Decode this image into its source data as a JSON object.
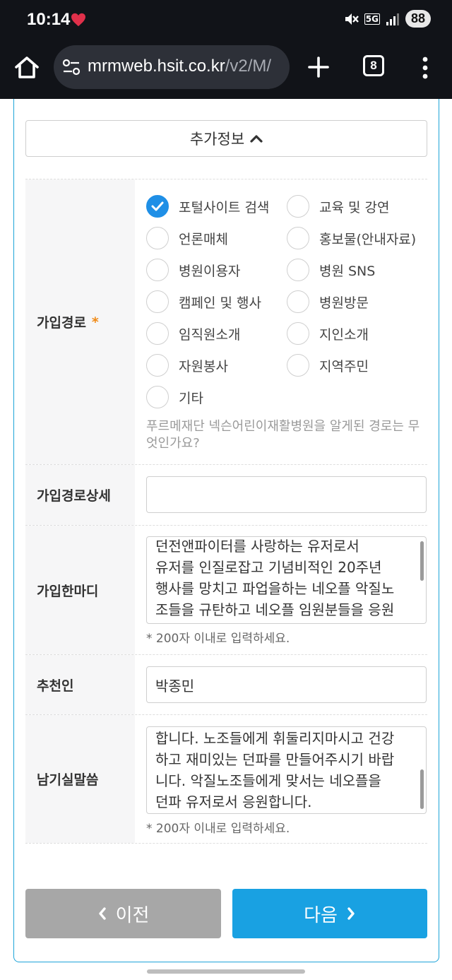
{
  "status": {
    "time": "10:14",
    "network": "5G",
    "battery": "88"
  },
  "browser": {
    "url_main": "mrmweb.hsit.co.kr",
    "url_path": "/v2/M/",
    "tab_count": "8"
  },
  "section_toggle": {
    "label": "추가정보"
  },
  "fields": {
    "join_route": {
      "label": "가입경로",
      "required": "*",
      "options": [
        {
          "label": "포털사이트 검색",
          "checked": true
        },
        {
          "label": "교육 및 강연",
          "checked": false
        },
        {
          "label": "언론매체",
          "checked": false
        },
        {
          "label": "홍보물(안내자료)",
          "checked": false
        },
        {
          "label": "병원이용자",
          "checked": false
        },
        {
          "label": "병원 SNS",
          "checked": false
        },
        {
          "label": "캠페인 및 행사",
          "checked": false
        },
        {
          "label": "병원방문",
          "checked": false
        },
        {
          "label": "임직원소개",
          "checked": false
        },
        {
          "label": "지인소개",
          "checked": false
        },
        {
          "label": "자원봉사",
          "checked": false
        },
        {
          "label": "지역주민",
          "checked": false
        },
        {
          "label": "기타",
          "checked": false
        }
      ],
      "hint": "푸르메재단 넥슨어린이재활병원을 알게된 경로는 무엇인가요?"
    },
    "join_route_detail": {
      "label": "가입경로상세",
      "value": ""
    },
    "join_message": {
      "label": "가입한마디",
      "lines": [
        "던전앤파이터를 사랑하는 유저로서",
        "유저를 인질로잡고 기념비적인 20주년",
        "행사를 망치고 파업을하는 네오플 악질노",
        "조들을 규탄하고 네오플 임원분들을 응원"
      ],
      "note": "* 200자 이내로 입력하세요."
    },
    "recommender": {
      "label": "추천인",
      "value": "박종민"
    },
    "leave_words": {
      "label": "남기실말씀",
      "lines": [
        "합니다. 노조들에게 휘둘리지마시고 건강",
        "하고 재미있는 던파를 만들어주시기 바랍",
        "니다. 악질노조들에게 맞서는 네오플을",
        "던파 유저로서 응원합니다."
      ],
      "note": "* 200자 이내로 입력하세요."
    }
  },
  "buttons": {
    "prev": "이전",
    "next": "다음"
  },
  "colors": {
    "accent": "#19a1e2",
    "checked": "#1f8fe6",
    "required": "#f08a16",
    "prev_bg": "#a7a7a7"
  }
}
